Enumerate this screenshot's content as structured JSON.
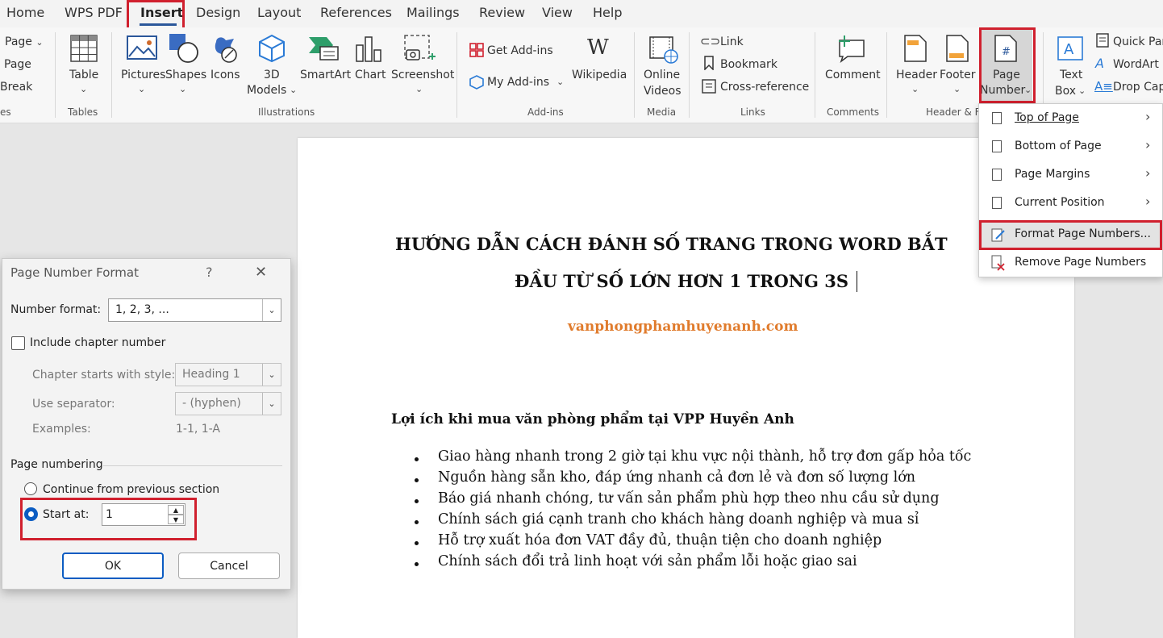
{
  "menu": {
    "tabs": [
      "Home",
      "WPS PDF",
      "Insert",
      "Design",
      "Layout",
      "References",
      "Mailings",
      "Review",
      "View",
      "Help"
    ],
    "active_tab": "Insert",
    "active_color": "#2b579a"
  },
  "ribbon": {
    "pages_group": {
      "page": "Page",
      "page2": "Page",
      "break": "Break",
      "label": "es"
    },
    "tables": {
      "table": "Table",
      "label": "Tables"
    },
    "illustrations": {
      "pictures": "Pictures",
      "shapes": "Shapes",
      "icons": "Icons",
      "models_1": "3D",
      "models_2": "Models",
      "smartart": "SmartArt",
      "chart": "Chart",
      "screenshot": "Screenshot",
      "label": "Illustrations"
    },
    "addins": {
      "get": "Get Add-ins",
      "my": "My Add-ins",
      "wikipedia": "Wikipedia",
      "label": "Add-ins"
    },
    "media": {
      "online_1": "Online",
      "online_2": "Videos",
      "label": "Media"
    },
    "links": {
      "link": "Link",
      "bookmark": "Bookmark",
      "crossref": "Cross-reference",
      "label": "Links"
    },
    "comments": {
      "comment": "Comment",
      "label": "Comments"
    },
    "header_footer": {
      "header": "Header",
      "footer": "Footer",
      "page_number_1": "Page",
      "page_number_2": "Number",
      "label": "Header & F"
    },
    "text": {
      "textbox_1": "Text",
      "textbox_2": "Box",
      "quickparts": "Quick Par",
      "wordart": "WordArt",
      "dropcap": "Drop Cap"
    }
  },
  "page_number_menu": {
    "items": [
      {
        "label": "Top of Page",
        "submenu": true
      },
      {
        "label": "Bottom of Page",
        "submenu": true
      },
      {
        "label": "Page Margins",
        "submenu": true
      },
      {
        "label": "Current Position",
        "submenu": true
      },
      {
        "label": "Format Page Numbers...",
        "submenu": false
      },
      {
        "label": "Remove Page Numbers",
        "submenu": false
      }
    ]
  },
  "document": {
    "title_line1": "HƯỚNG DẪN CÁCH ĐÁNH SỐ TRANG TRONG WORD BẮT",
    "title_line2": "ĐẦU TỪ SỐ LỚN HƠN 1 TRONG 3S",
    "website": "vanphongphamhuyenanh.com",
    "website_color": "#e07b2c",
    "subheading": "Lợi ích khi mua văn phòng phẩm tại VPP Huyền Anh",
    "bullets": [
      "Giao hàng nhanh trong 2 giờ tại khu vực nội thành, hỗ trợ đơn gấp hỏa tốc",
      "Nguồn hàng sẵn kho, đáp ứng nhanh cả đơn lẻ và đơn số lượng lớn",
      "Báo giá nhanh chóng, tư vấn sản phẩm phù hợp theo nhu cầu sử dụng",
      "Chính sách giá cạnh tranh cho khách hàng doanh nghiệp và mua sỉ",
      "Hỗ trợ xuất hóa đơn VAT đầy đủ, thuận tiện cho doanh nghiệp",
      "Chính sách đổi trả linh hoạt với sản phẩm lỗi hoặc giao sai"
    ]
  },
  "dialog": {
    "title": "Page Number Format",
    "help": "?",
    "close": "✕",
    "number_format_label": "Number format:",
    "number_format_value": "1, 2, 3, ...",
    "include_chapter": "Include chapter number",
    "chapter_style_label": "Chapter starts with style:",
    "chapter_style_value": "Heading 1",
    "separator_label": "Use separator:",
    "separator_value": "-   (hyphen)",
    "examples_label": "Examples:",
    "examples_value": "1-1, 1-A",
    "page_numbering": "Page numbering",
    "continue_label": "Continue from previous section",
    "start_at_label": "Start at:",
    "start_at_value": "1",
    "ok": "OK",
    "cancel": "Cancel"
  },
  "highlight_color": "#d0202e"
}
